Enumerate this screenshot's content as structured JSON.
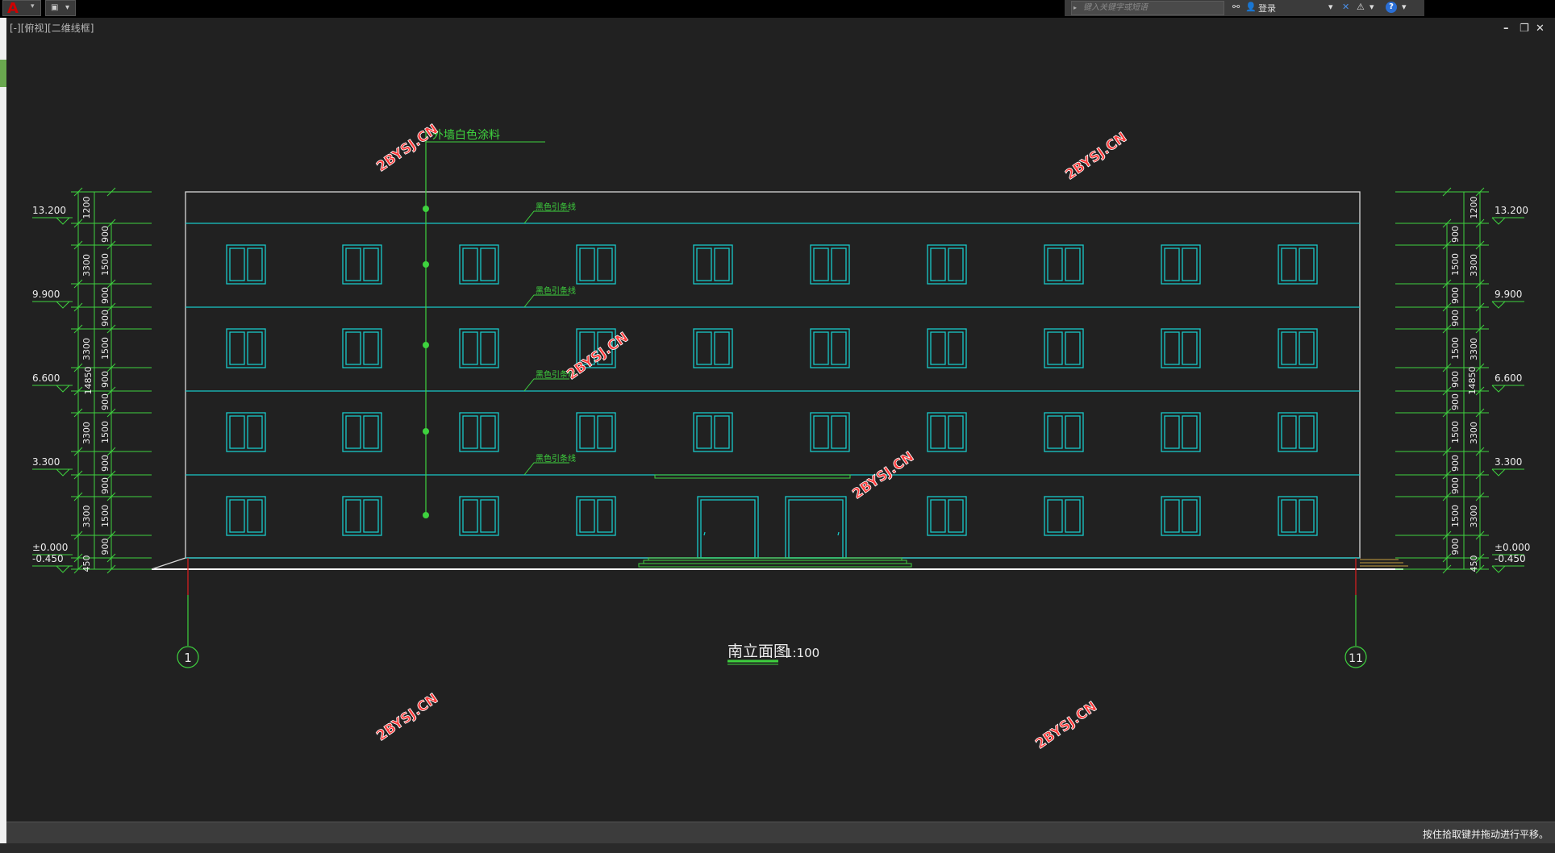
{
  "toolbar": {
    "app_icon": "autocad-a-icon",
    "search_placeholder": "键入关键字或短语",
    "login_label": "登录"
  },
  "viewport": {
    "label": "[-][俯视][二维线框]"
  },
  "drawing": {
    "title": "南立面图",
    "scale": "1:100",
    "note_top": "外墙白色涂料",
    "band_note": "黑色引条线",
    "axis_left": "1",
    "axis_right": "11",
    "watermark": "2BYSJ.CN",
    "total_height": "14850",
    "elevations": [
      "13.200",
      "9.900",
      "6.600",
      "3.300",
      "±0.000",
      "-0.450"
    ],
    "outer_dims": [
      "1200",
      "3300",
      "3300",
      "3300",
      "3300",
      "450"
    ],
    "inner_dims_floor": [
      "900",
      "1500",
      "900"
    ],
    "inner_dim_parapet": "900"
  },
  "status": {
    "message": "按住拾取键并拖动进行平移。"
  }
}
